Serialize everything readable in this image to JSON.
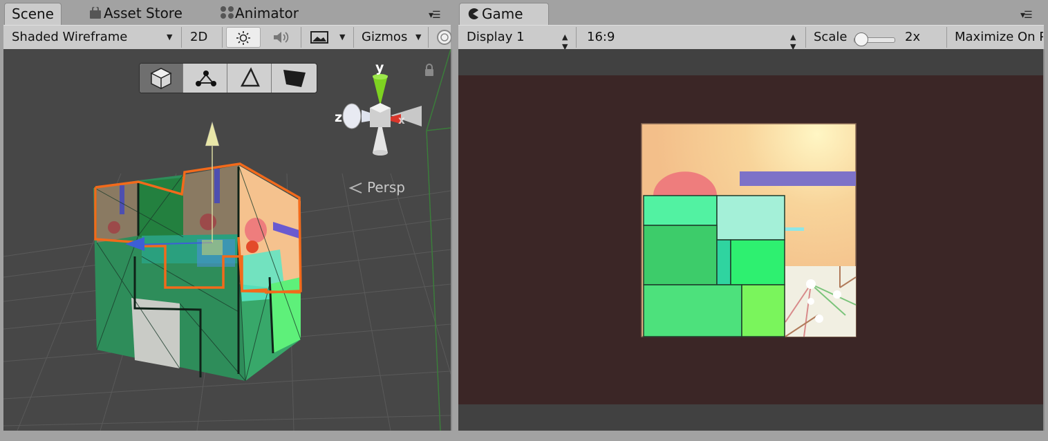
{
  "scene_tabs": [
    {
      "label": "Scene",
      "active": true,
      "icon": "none"
    },
    {
      "label": "Asset Store",
      "active": false,
      "icon": "shopping-bag-icon"
    },
    {
      "label": "Animator",
      "active": false,
      "icon": "animator-icon"
    }
  ],
  "game_tabs": [
    {
      "label": "Game",
      "active": true,
      "icon": "pacman-icon"
    }
  ],
  "scene_toolbar": {
    "draw_mode": "Shaded Wireframe",
    "mode_2d": "2D",
    "lighting_icon": "sun-icon",
    "audio_icon": "speaker-icon",
    "effects_icon": "image-icon",
    "gizmos": "Gizmos",
    "search_icon": "search-icon"
  },
  "game_toolbar": {
    "display": "Display 1",
    "aspect": "16:9",
    "scale_label": "Scale",
    "scale_value": "2x",
    "maximize": "Maximize On P",
    "scale_slider_level": 0.05
  },
  "gizmo": {
    "y_label": "y",
    "z_label": "z",
    "x_label": "x",
    "projection": "Persp"
  },
  "edit_tools": [
    {
      "name": "cube-mode-icon",
      "active": true
    },
    {
      "name": "vertex-mode-icon",
      "active": false
    },
    {
      "name": "edge-mode-icon",
      "active": false
    },
    {
      "name": "face-mode-icon",
      "active": false
    }
  ],
  "colors": {
    "scene_background": "#474747",
    "game_background": "#3b2626",
    "selection_outline": "#f26a1b",
    "wireframe_green": "#2f9a55",
    "axis_y": "#7ed321",
    "axis_x": "#d9362b",
    "axis_z": "#3b6bd9"
  }
}
